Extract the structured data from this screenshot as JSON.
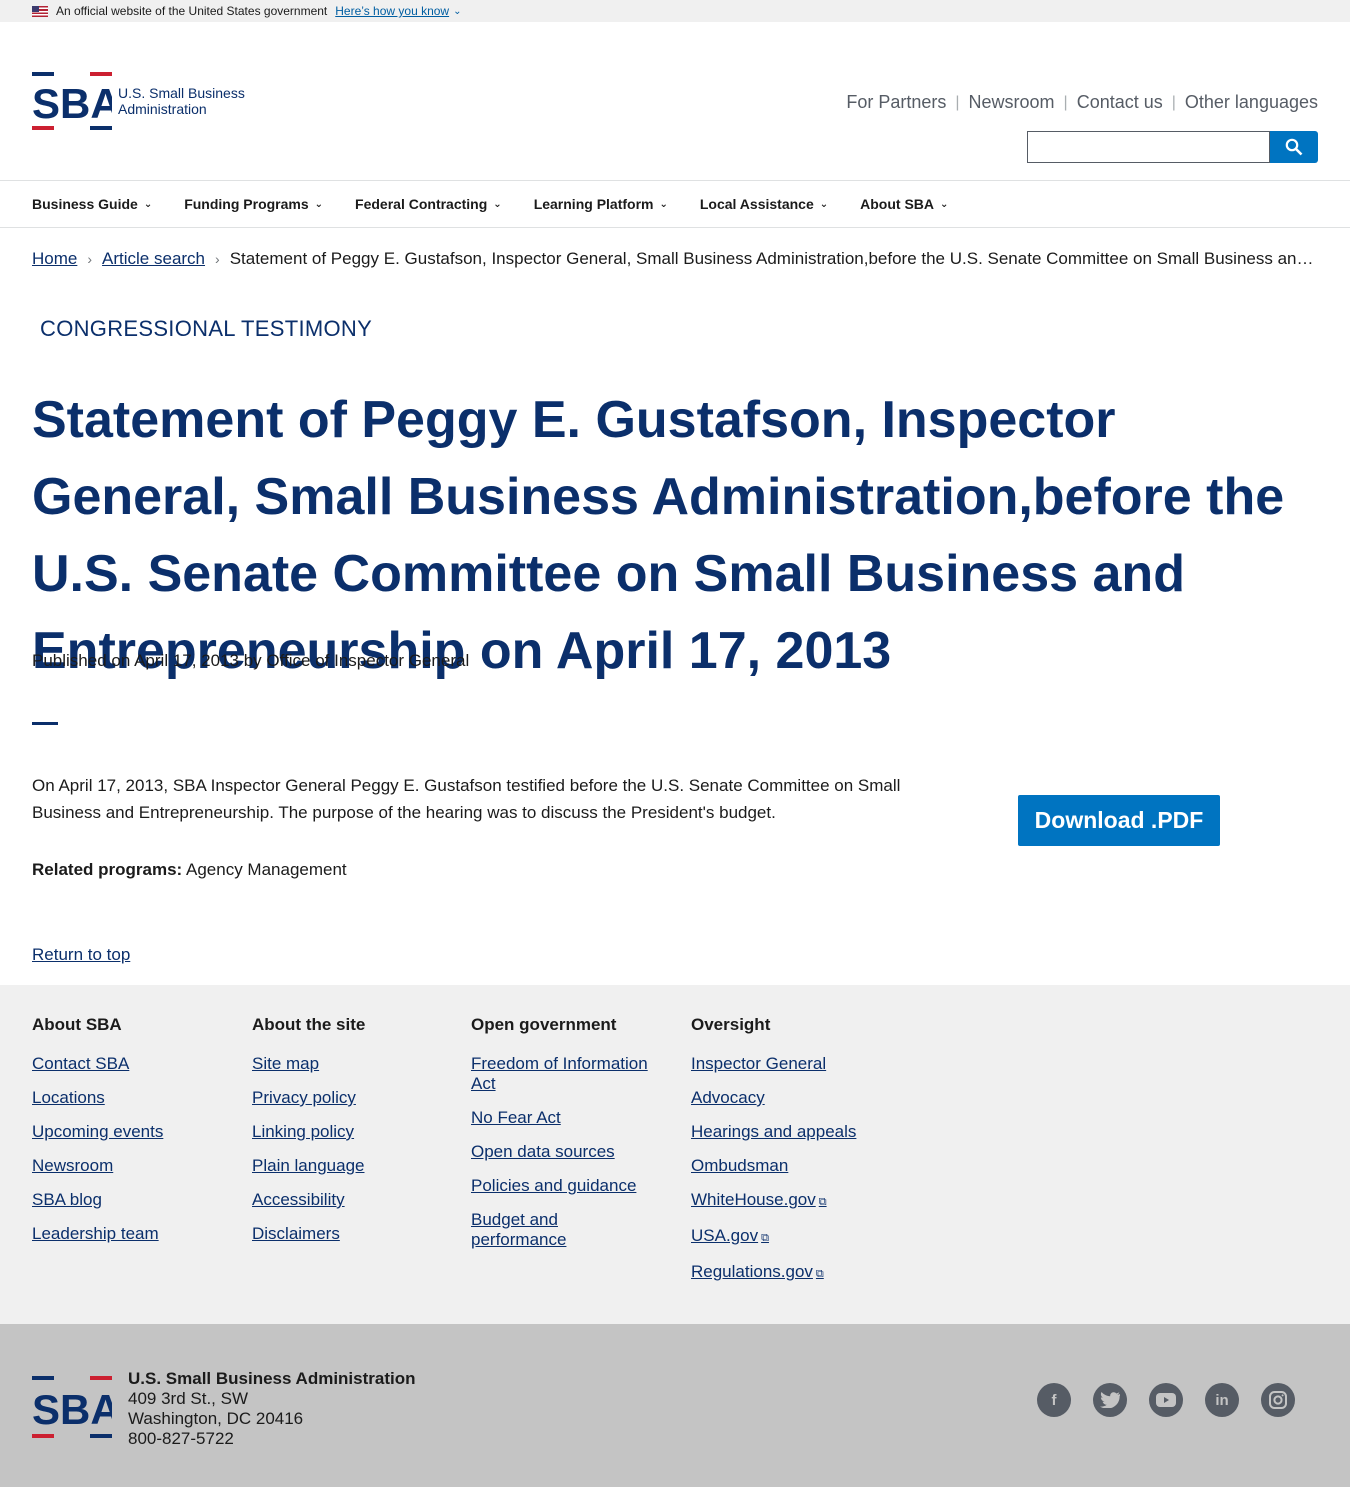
{
  "banner": {
    "text": "An official website of the United States government",
    "link": "Here’s how you know"
  },
  "header": {
    "logo_mark": "SBA",
    "logo_text": "U.S. Small Business Administration",
    "utility": [
      "For Partners",
      "Newsroom",
      "Contact us",
      "Other languages"
    ],
    "search": {
      "value": "",
      "placeholder": ""
    }
  },
  "nav": [
    "Business Guide",
    "Funding Programs",
    "Federal Contracting",
    "Learning Platform",
    "Local Assistance",
    "About SBA"
  ],
  "breadcrumb": {
    "home": "Home",
    "article_search": "Article search",
    "current": "Statement of Peggy E. Gustafson, Inspector General, Small Business Administration,before the U.S. Senate Committee on Small Business and …"
  },
  "article": {
    "eyebrow": "CONGRESSIONAL TESTIMONY",
    "title": "Statement of Peggy E. Gustafson, Inspector General, Small Business Administration,before the U.S. Senate Committee on Small Business and Entrepreneurship on April 17, 2013",
    "published": "Published on April 17, 2013 by Office of Inspector General",
    "body": "On April 17, 2013,  SBA Inspector General Peggy E. Gustafson testified before the U.S. Senate Committee on Small Business and Entrepreneurship.  The purpose of the hearing was to discuss the President's budget.",
    "download_label": "Download .PDF",
    "related_label": "Related programs:",
    "related_value": "Agency Management",
    "return_top": "Return to top"
  },
  "footer": {
    "columns": [
      {
        "heading": "About SBA",
        "links": [
          "Contact SBA",
          "Locations",
          "Upcoming events",
          "Newsroom",
          "SBA blog",
          "Leadership team"
        ]
      },
      {
        "heading": "About the site",
        "links": [
          "Site map",
          "Privacy policy",
          "Linking policy",
          "Plain language",
          "Accessibility",
          "Disclaimers"
        ]
      },
      {
        "heading": "Open government",
        "links": [
          "Freedom of Information Act",
          "No Fear Act",
          "Open data sources",
          "Policies and guidance",
          "Budget and performance"
        ]
      },
      {
        "heading": "Oversight",
        "links": [
          "Inspector General",
          "Advocacy",
          "Hearings and appeals",
          "Ombudsman",
          "WhiteHouse.gov",
          "USA.gov",
          "Regulations.gov"
        ]
      }
    ],
    "org": "U.S. Small Business Administration",
    "address1": "409 3rd St., SW",
    "address2": "Washington, DC 20416",
    "phone": "800-827-5722",
    "social": [
      "facebook-icon",
      "twitter-icon",
      "youtube-icon",
      "linkedin-icon",
      "instagram-icon"
    ]
  },
  "colors": {
    "navy": "#0b2f6b",
    "primary_blue": "#0074c1",
    "red": "#cc2031",
    "footer_gray": "#c4c4c4"
  }
}
